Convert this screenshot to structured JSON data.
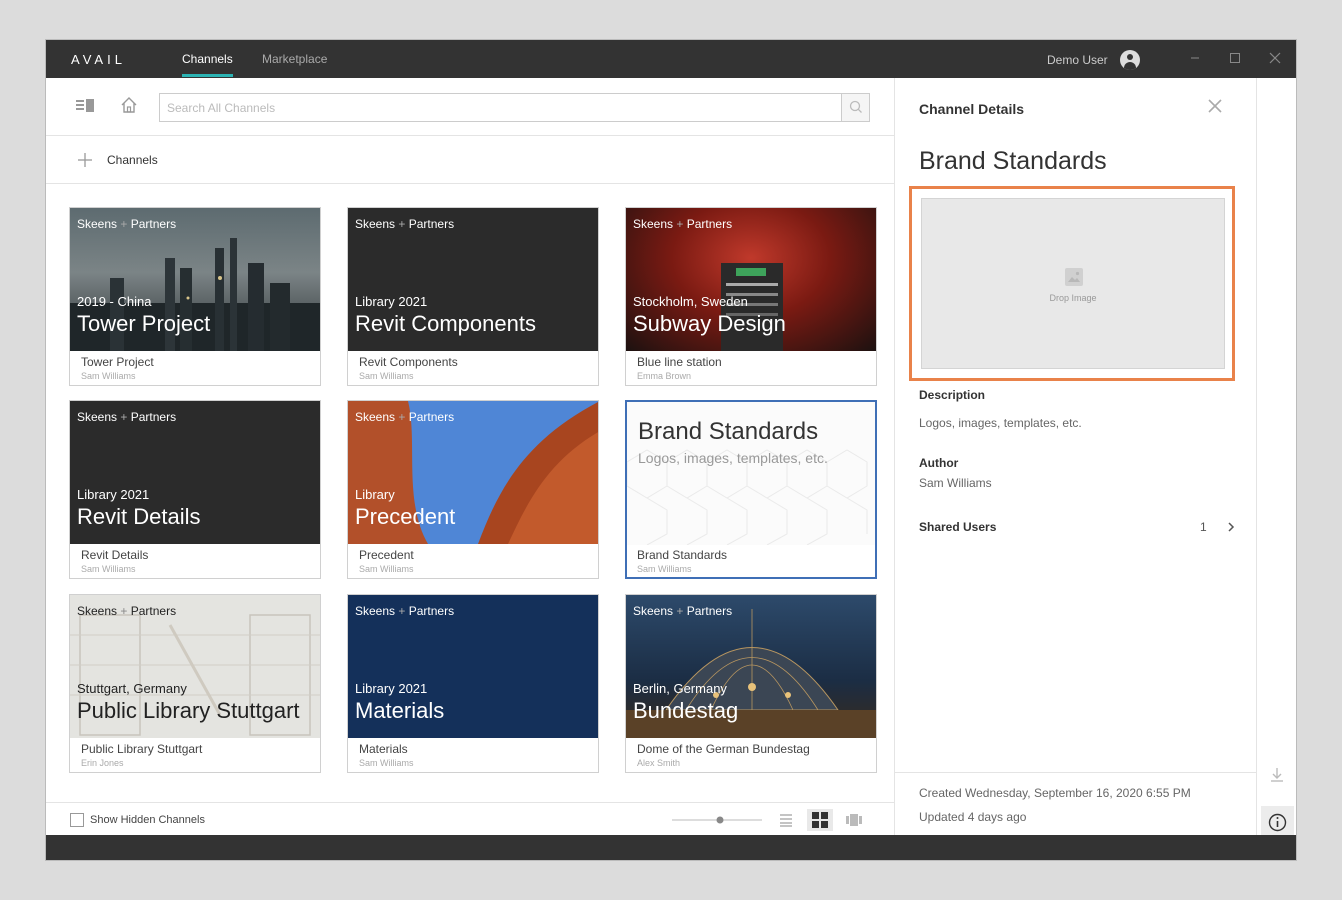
{
  "app": {
    "logo": "AVAIL",
    "tabs": [
      {
        "label": "Channels",
        "active": true
      },
      {
        "label": "Marketplace",
        "active": false
      }
    ],
    "user": "Demo User",
    "window_controls": [
      "minimize",
      "maximize",
      "close"
    ]
  },
  "toolbar": {
    "search_placeholder": "Search All Channels"
  },
  "breadcrumb": {
    "label": "Channels"
  },
  "brand": {
    "left": "Skeens",
    "sep": "+",
    "right": "Partners"
  },
  "cards": [
    {
      "subtitle": "2019 - China",
      "title": "Tower Project",
      "caption": "Tower Project",
      "author": "Sam Williams"
    },
    {
      "subtitle": "Library 2021",
      "title": "Revit Components",
      "caption": "Revit Components",
      "author": "Sam Williams"
    },
    {
      "subtitle": "Stockholm, Sweden",
      "title": "Subway Design",
      "caption": "Blue line station",
      "author": "Emma Brown"
    },
    {
      "subtitle": "Library 2021",
      "title": "Revit Details",
      "caption": "Revit Details",
      "author": "Sam Williams"
    },
    {
      "subtitle": "Library",
      "title": "Precedent",
      "caption": "Precedent",
      "author": "Sam Williams"
    },
    {
      "subtitle": "Logos, images, templates, etc.",
      "title": "Brand Standards",
      "caption": "Brand Standards",
      "author": "Sam Williams",
      "selected": true
    },
    {
      "subtitle": "Stuttgart, Germany",
      "title": "Public Library Stuttgart",
      "caption": "Public Library Stuttgart",
      "author": "Erin Jones"
    },
    {
      "subtitle": "Library 2021",
      "title": "Materials",
      "caption": "Materials",
      "author": "Sam Williams"
    },
    {
      "subtitle": "Berlin, Germany",
      "title": "Bundestag",
      "caption": "Dome of the German Bundestag",
      "author": "Alex Smith"
    }
  ],
  "footer": {
    "show_hidden_label": "Show Hidden Channels",
    "show_hidden_checked": false,
    "view_modes": [
      "list",
      "grid",
      "carousel"
    ],
    "active_view": "grid"
  },
  "details": {
    "header": "Channel Details",
    "title": "Brand Standards",
    "drop_label": "Drop Image",
    "description_label": "Description",
    "description": "Logos, images, templates, etc.",
    "author_label": "Author",
    "author": "Sam Williams",
    "shared_label": "Shared Users",
    "shared_count": "1",
    "created": "Created Wednesday, September 16, 2020 6:55 PM",
    "updated": "Updated 4 days ago"
  },
  "colors": {
    "titlebar": "#333333",
    "accent": "#2bb3b3",
    "selection": "#3f6fb6",
    "highlight": "#e9824a"
  }
}
